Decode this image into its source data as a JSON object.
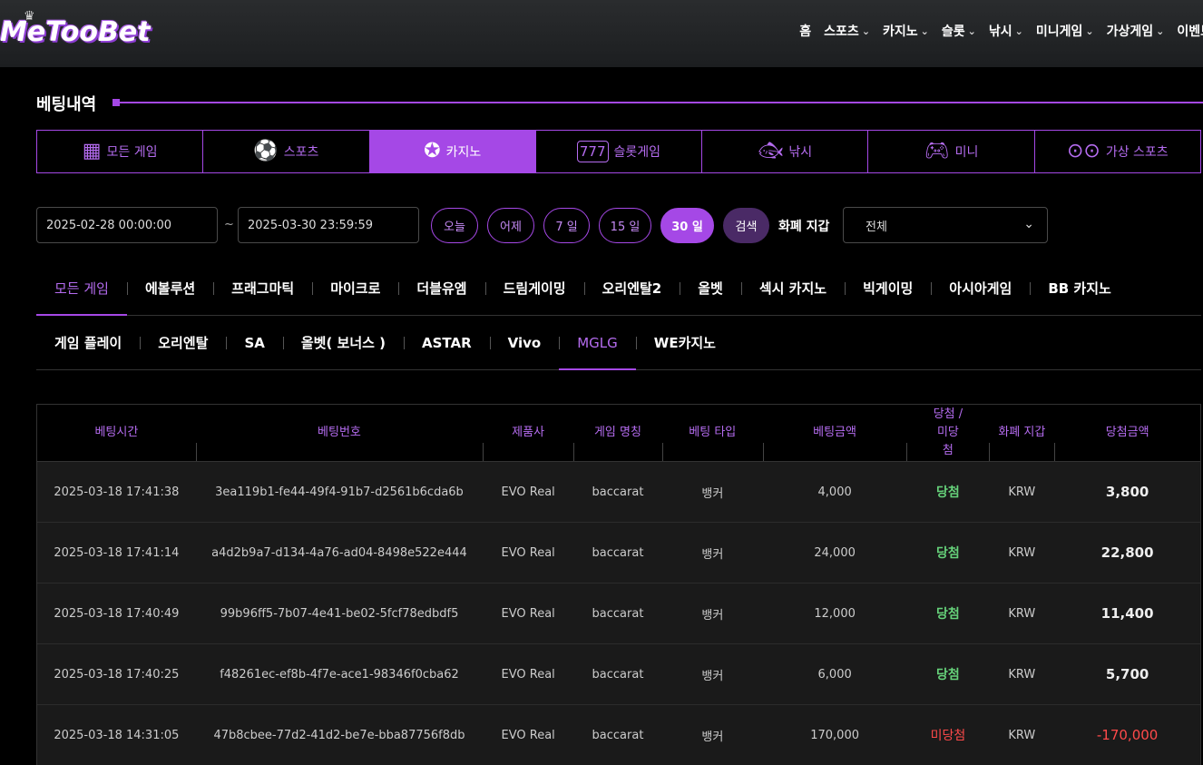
{
  "header": {
    "logo": "MeTooBet",
    "nav": [
      {
        "label": "홈",
        "chevron": false
      },
      {
        "label": "스포츠",
        "chevron": true
      },
      {
        "label": "카지노",
        "chevron": true
      },
      {
        "label": "슬롯",
        "chevron": true
      },
      {
        "label": "낚시",
        "chevron": true
      },
      {
        "label": "미니게임",
        "chevron": true
      },
      {
        "label": "가상게임",
        "chevron": true
      },
      {
        "label": "이벤트",
        "chevron": false
      }
    ]
  },
  "page": {
    "title": "베팅내역"
  },
  "game_tabs": [
    {
      "label": "모든 게임",
      "icon": "grid-icon",
      "active": false
    },
    {
      "label": "스포츠",
      "icon": "soccer-ball-icon",
      "active": false
    },
    {
      "label": "카지노",
      "icon": "poker-chip-icon",
      "active": true
    },
    {
      "label": "슬롯게임",
      "icon": "slot-777-icon",
      "active": false
    },
    {
      "label": "낚시",
      "icon": "fish-icon",
      "active": false
    },
    {
      "label": "미니",
      "icon": "gamepad-icon",
      "active": false
    },
    {
      "label": "가상 스포츠",
      "icon": "vr-goggles-icon",
      "active": false
    }
  ],
  "filters": {
    "date_from": "2025-02-28 00:00:00",
    "date_to": "2025-03-30 23:59:59",
    "separator": "~",
    "periods": [
      "오늘",
      "어제",
      "7 일",
      "15 일",
      "30 일"
    ],
    "active_period": "30 일",
    "search_label": "검색",
    "wallet_label": "화폐 지갑",
    "wallet_value": "전체"
  },
  "providers_row1": [
    "모든 게임",
    "에볼루션",
    "프래그마틱",
    "마이크로",
    "더블유엠",
    "드림게이밍",
    "오리엔탈2",
    "올벳",
    "섹시 카지노",
    "빅게이밍",
    "아시아게임",
    "BB 카지노"
  ],
  "providers_row2": [
    "게임 플레이",
    "오리엔탈",
    "SA",
    "올벳( 보너스 )",
    "ASTAR",
    "Vivo",
    "MGLG",
    "WE카지노"
  ],
  "active_providers": [
    "모든 게임",
    "MGLG"
  ],
  "table": {
    "headers": [
      "베팅시간",
      "베팅번호",
      "제품사",
      "게임 명칭",
      "베팅 타입",
      "베팅금액",
      "당첨 / 미당첨",
      "화폐 지갑",
      "당첨금액"
    ],
    "rows": [
      {
        "time": "2025-03-18 17:41:38",
        "id": "3ea119b1-fe44-49f4-91b7-d2561b6cda6b",
        "vendor": "EVO Real",
        "game": "baccarat",
        "type": "뱅커",
        "bet": "4,000",
        "result": "당첨",
        "win": true,
        "wallet": "KRW",
        "payout": "3,800"
      },
      {
        "time": "2025-03-18 17:41:14",
        "id": "a4d2b9a7-d134-4a76-ad04-8498e522e444",
        "vendor": "EVO Real",
        "game": "baccarat",
        "type": "뱅커",
        "bet": "24,000",
        "result": "당첨",
        "win": true,
        "wallet": "KRW",
        "payout": "22,800"
      },
      {
        "time": "2025-03-18 17:40:49",
        "id": "99b96ff5-7b07-4e41-be02-5fcf78edbdf5",
        "vendor": "EVO Real",
        "game": "baccarat",
        "type": "뱅커",
        "bet": "12,000",
        "result": "당첨",
        "win": true,
        "wallet": "KRW",
        "payout": "11,400"
      },
      {
        "time": "2025-03-18 17:40:25",
        "id": "f48261ec-ef8b-4f7e-ace1-98346f0cba62",
        "vendor": "EVO Real",
        "game": "baccarat",
        "type": "뱅커",
        "bet": "6,000",
        "result": "당첨",
        "win": true,
        "wallet": "KRW",
        "payout": "5,700"
      },
      {
        "time": "2025-03-18 14:31:05",
        "id": "47b8cbee-77d2-41d2-be7e-bba87756f8db",
        "vendor": "EVO Real",
        "game": "baccarat",
        "type": "뱅커",
        "bet": "170,000",
        "result": "미당첨",
        "win": false,
        "wallet": "KRW",
        "payout": "-170,000"
      }
    ]
  },
  "colors": {
    "accent": "#a548e6",
    "win": "#66d27a",
    "lose": "#ff4a4a"
  }
}
